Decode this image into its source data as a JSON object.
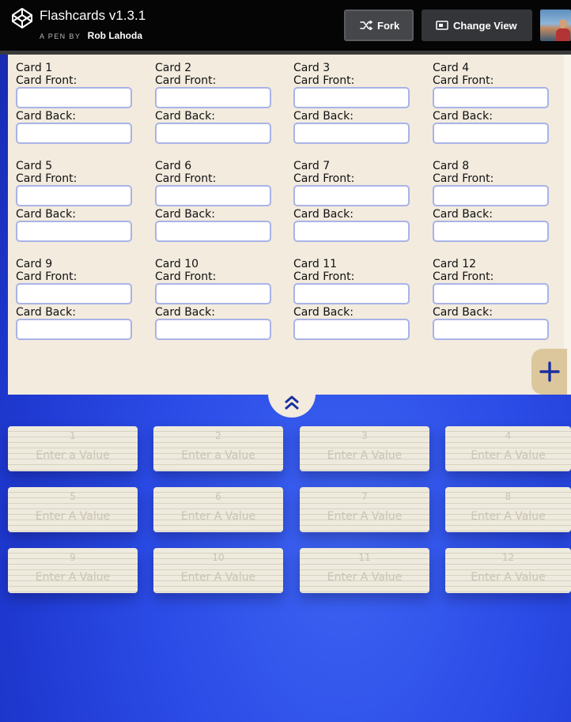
{
  "header": {
    "title": "Flashcards v1.3.1",
    "pen_label": "A PEN BY",
    "author": "Rob Lahoda",
    "fork_label": "Fork",
    "change_view_label": "Change View"
  },
  "editor": {
    "front_label": "Card Front:",
    "back_label": "Card Back:",
    "cards": [
      {
        "title": "Card 1",
        "front": "",
        "back": ""
      },
      {
        "title": "Card 2",
        "front": "",
        "back": ""
      },
      {
        "title": "Card 3",
        "front": "",
        "back": ""
      },
      {
        "title": "Card 4",
        "front": "",
        "back": ""
      },
      {
        "title": "Card 5",
        "front": "",
        "back": ""
      },
      {
        "title": "Card 6",
        "front": "",
        "back": ""
      },
      {
        "title": "Card 7",
        "front": "",
        "back": ""
      },
      {
        "title": "Card 8",
        "front": "",
        "back": ""
      },
      {
        "title": "Card 9",
        "front": "",
        "back": ""
      },
      {
        "title": "Card 10",
        "front": "",
        "back": ""
      },
      {
        "title": "Card 11",
        "front": "",
        "back": ""
      },
      {
        "title": "Card 12",
        "front": "",
        "back": ""
      }
    ]
  },
  "flashcards": [
    {
      "number": "1",
      "text": "Enter a Value"
    },
    {
      "number": "2",
      "text": "Enter a Value"
    },
    {
      "number": "3",
      "text": "Enter A Value"
    },
    {
      "number": "4",
      "text": "Enter A Value"
    },
    {
      "number": "5",
      "text": "Enter A Value"
    },
    {
      "number": "6",
      "text": "Enter A Value"
    },
    {
      "number": "7",
      "text": "Enter A Value"
    },
    {
      "number": "8",
      "text": "Enter A Value"
    },
    {
      "number": "9",
      "text": "Enter A Value"
    },
    {
      "number": "10",
      "text": "Enter A Value"
    },
    {
      "number": "11",
      "text": "Enter A Value"
    },
    {
      "number": "12",
      "text": "Enter A Value"
    }
  ],
  "icons": {
    "logo": "codepen-logo-icon",
    "fork": "fork-icon",
    "change_view": "change-view-icon",
    "add": "plus-icon",
    "collapse": "double-chevron-up-icon"
  },
  "colors": {
    "header_bg": "#050505",
    "panel_bg": "#f2ebde",
    "input_border": "#a9b3e6",
    "accent_blue": "#1e38cf",
    "add_button_bg": "#dcc79c",
    "card_bg": "#eeeadd"
  }
}
